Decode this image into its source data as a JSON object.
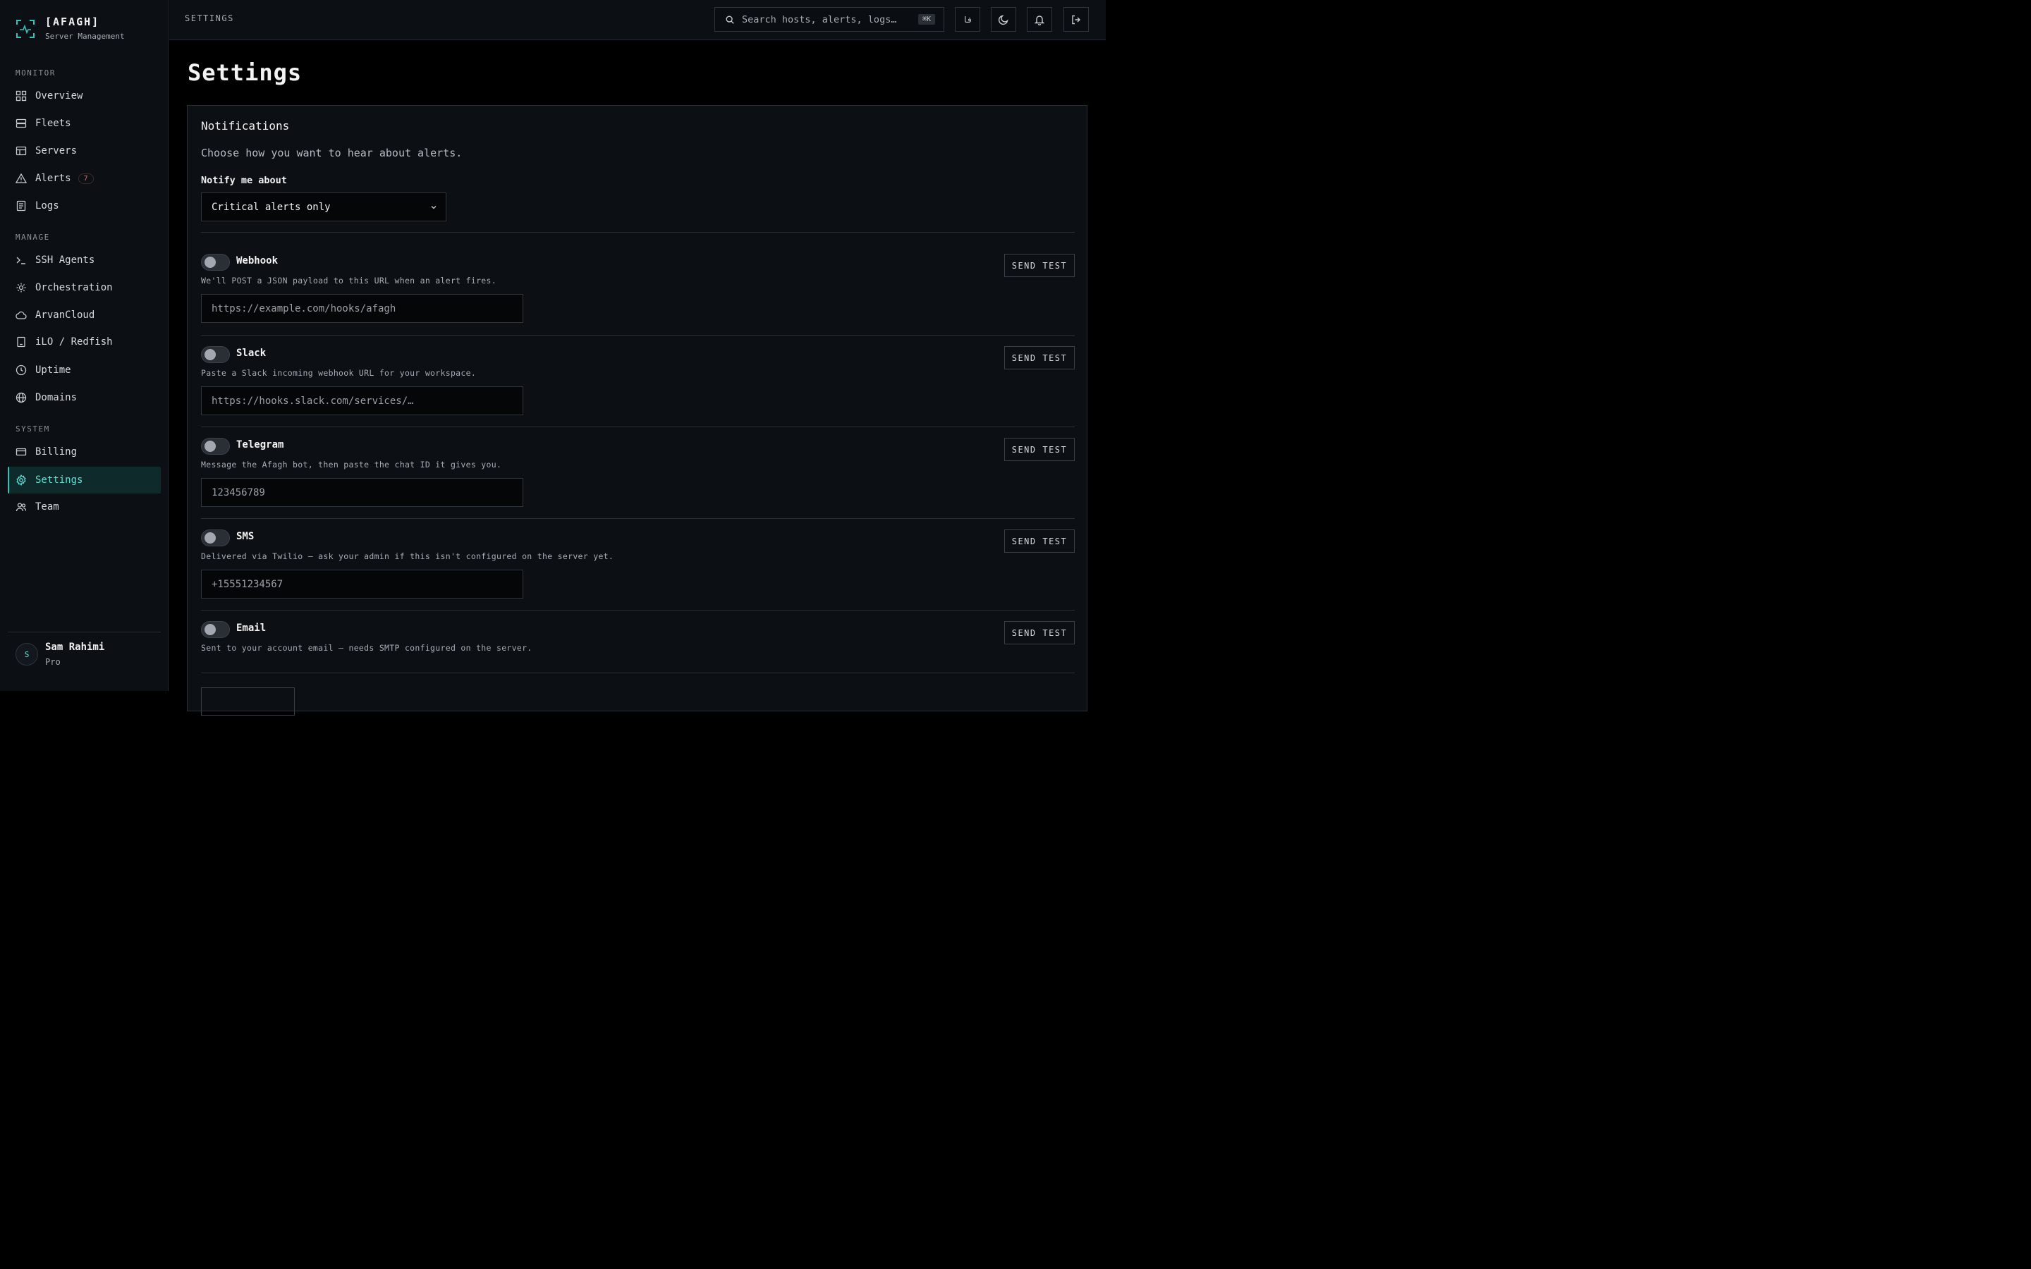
{
  "brand": {
    "name": "[AFAGH]",
    "subtitle": "Server Management"
  },
  "sidebar": {
    "sections": {
      "monitor": "MONITOR",
      "manage": "MANAGE",
      "system": "SYSTEM"
    },
    "items": [
      {
        "label": "Overview",
        "icon": "grid-icon"
      },
      {
        "label": "Fleets",
        "icon": "server-stack-icon"
      },
      {
        "label": "Servers",
        "icon": "table-icon"
      },
      {
        "label": "Alerts",
        "icon": "warning-triangle-icon",
        "badge": "7"
      },
      {
        "label": "Logs",
        "icon": "document-icon"
      },
      {
        "label": "SSH Agents",
        "icon": "terminal-icon"
      },
      {
        "label": "Orchestration",
        "icon": "sun-cog-icon"
      },
      {
        "label": "ArvanCloud",
        "icon": "cloud-icon"
      },
      {
        "label": "iLO / Redfish",
        "icon": "device-icon"
      },
      {
        "label": "Uptime",
        "icon": "clock-icon"
      },
      {
        "label": "Domains",
        "icon": "globe-icon"
      },
      {
        "label": "Billing",
        "icon": "credit-card-icon"
      },
      {
        "label": "Settings",
        "icon": "gear-icon",
        "active": true
      },
      {
        "label": "Team",
        "icon": "users-icon"
      }
    ],
    "user": {
      "initial": "S",
      "name": "Sam Rahimi",
      "plan": "Pro"
    }
  },
  "topbar": {
    "breadcrumb": "SETTINGS",
    "search_placeholder": "Search hosts, alerts, logs…",
    "shortcut": "⌘K",
    "lang_label": "فا"
  },
  "page": {
    "title": "Settings"
  },
  "notifications": {
    "title": "Notifications",
    "description": "Choose how you want to hear about alerts.",
    "notify_label": "Notify me about",
    "notify_value": "Critical alerts only",
    "send_test_label": "SEND TEST",
    "channels": [
      {
        "name": "Webhook",
        "description": "We'll POST a JSON payload to this URL when an alert fires.",
        "placeholder": "https://example.com/hooks/afagh",
        "enabled": false
      },
      {
        "name": "Slack",
        "description": "Paste a Slack incoming webhook URL for your workspace.",
        "placeholder": "https://hooks.slack.com/services/…",
        "enabled": false
      },
      {
        "name": "Telegram",
        "description": "Message the Afagh bot, then paste the chat ID it gives you.",
        "placeholder": "123456789",
        "enabled": false
      },
      {
        "name": "SMS",
        "description": "Delivered via Twilio — ask your admin if this isn't configured on the server yet.",
        "placeholder": "+15551234567",
        "enabled": false
      },
      {
        "name": "Email",
        "description": "Sent to your account email — needs SMTP configured on the server.",
        "enabled": false
      }
    ]
  },
  "colors": {
    "accent": "#2fc7b8",
    "alert_badge": "#ef6b6b",
    "background": "#000000",
    "surface": "#0c0f14"
  }
}
